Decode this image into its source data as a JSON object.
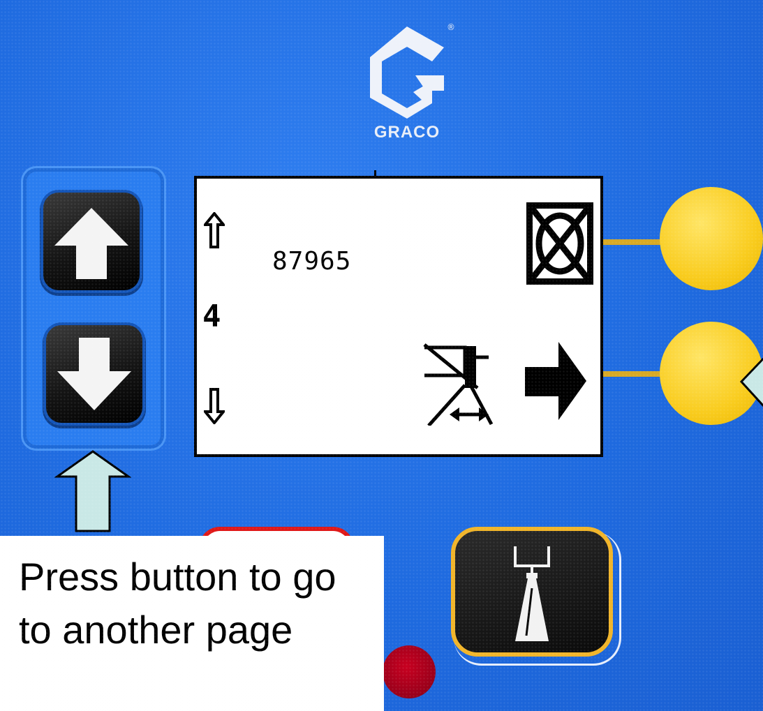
{
  "brand": {
    "name": "GRACO",
    "registered_mark": "®"
  },
  "lcd": {
    "value": "87965",
    "page_number": "4",
    "icons": {
      "scroll_up": "up-arrow-icon",
      "scroll_down": "down-arrow-icon",
      "top_right": "crossed-circle-icon",
      "bottom_middle": "spray-width-icon",
      "bottom_right": "right-arrow-icon"
    }
  },
  "keypad": {
    "up_key_icon": "up-arrow-icon",
    "down_key_icon": "down-arrow-icon",
    "spray_key_icon": "spray-gun-icon"
  },
  "caption": {
    "text": "Press button to go to another page"
  },
  "colors": {
    "panel_blue": "#1f6be0",
    "button_yellow": "#f9cc1e",
    "callout_fill": "#c9e8e6",
    "spray_button_border": "#f1b52a",
    "stop_button_red": "#e01818"
  }
}
